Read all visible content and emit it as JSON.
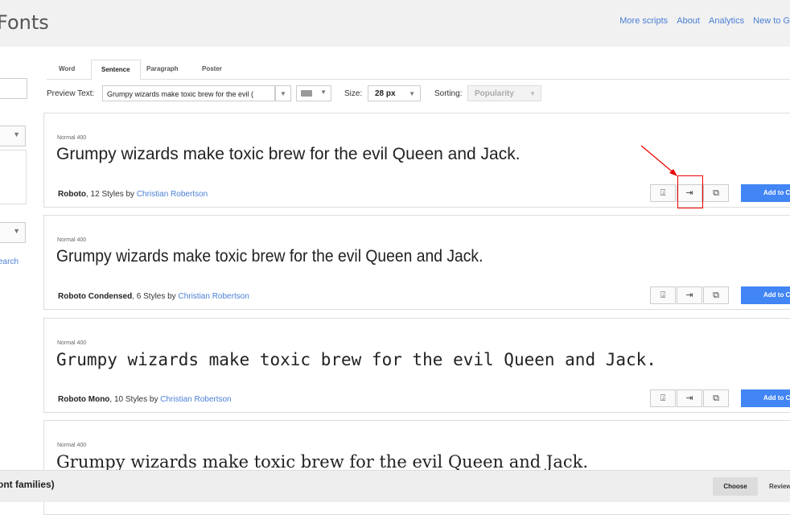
{
  "header": {
    "logo": "Fonts",
    "nav": [
      "More scripts",
      "About",
      "Analytics",
      "New to G"
    ]
  },
  "sidebar": {
    "link": "earch"
  },
  "tabs": [
    {
      "label": "Word",
      "active": false
    },
    {
      "label": "Sentence",
      "active": true
    },
    {
      "label": "Paragraph",
      "active": false
    },
    {
      "label": "Poster",
      "active": false
    }
  ],
  "toolbar": {
    "preview_label": "Preview Text:",
    "preview_value": "Grumpy wizards make toxic brew for the evil (",
    "size_label": "Size:",
    "size_value": "28 px",
    "sorting_label": "Sorting:",
    "sorting_value": "Popularity",
    "keyboard_icon": "keyboard-icon"
  },
  "cards": [
    {
      "style_label": "Normal 400",
      "sample": "Grumpy wizards make toxic brew for the evil Queen and Jack.",
      "name": "Roboto",
      "styles": ", 12 Styles by ",
      "author": "Christian Robertson",
      "add_label": "Add to C"
    },
    {
      "style_label": "Normal 400",
      "sample": "Grumpy wizards make toxic brew for the evil Queen and Jack.",
      "name": "Roboto Condensed",
      "styles": ", 6 Styles by ",
      "author": "Christian Robertson",
      "add_label": "Add to C"
    },
    {
      "style_label": "Normal 400",
      "sample": "Grumpy wizards make toxic brew for the evil Queen and Jack.",
      "name": "Roboto Mono",
      "styles": ", 10 Styles by ",
      "author": "Christian Robertson",
      "add_label": "Add to C"
    },
    {
      "style_label": "Normal 400",
      "sample": "Grumpy wizards make toxic brew for the evil Queen and Jack."
    }
  ],
  "bottom_bar": {
    "families_label": "ont families)",
    "choose_label": "Choose",
    "review_label": "Review"
  },
  "colors": {
    "accent": "#4285f4",
    "link": "#4a7fd6",
    "annotation": "#ee0000"
  }
}
